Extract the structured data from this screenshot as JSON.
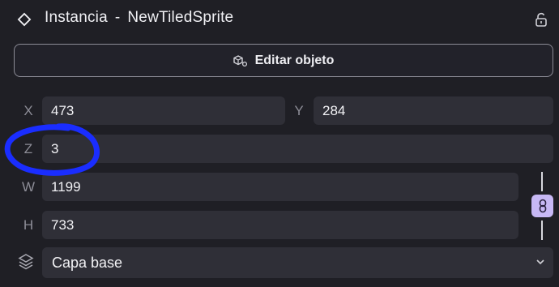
{
  "header": {
    "instance_label": "Instancia",
    "separator": "-",
    "object_name": "NewTiledSprite"
  },
  "actions": {
    "edit_object_label": "Editar objeto"
  },
  "position": {
    "x_label": "X",
    "x_value": "473",
    "y_label": "Y",
    "y_value": "284",
    "z_label": "Z",
    "z_value": "3"
  },
  "size": {
    "w_label": "W",
    "w_value": "1199",
    "h_label": "H",
    "h_value": "733",
    "keep_ratio": true
  },
  "layer": {
    "selected": "Capa base"
  },
  "colors": {
    "panel_bg": "#1f1f25",
    "field_bg": "#2f2f37",
    "accent": "#c7b8f5",
    "annotation": "#1a2dff"
  },
  "icons": {
    "header": "diamond-icon",
    "lock": "lock-open-icon",
    "edit": "object-icon",
    "ratio": "link-icon",
    "layer": "layers-icon",
    "dropdown": "chevron-down-icon"
  }
}
